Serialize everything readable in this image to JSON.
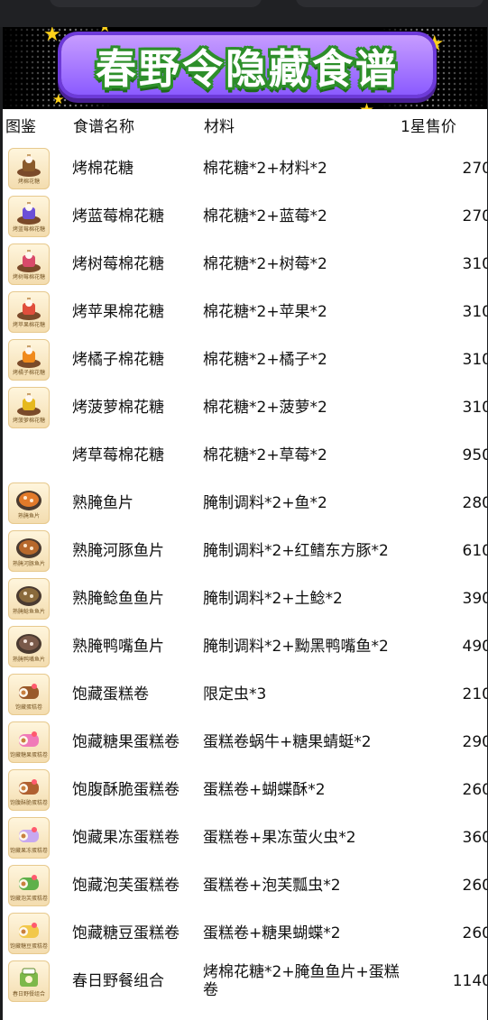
{
  "banner": {
    "title": "春野令隐藏食谱"
  },
  "columns": {
    "icon": "图鉴",
    "name": "食谱名称",
    "materials": "材料",
    "price": "1星售价"
  },
  "colors": {
    "banner_bg": "#000000",
    "title_fill": "#ffffff",
    "title_outline": "#2d8f2a",
    "title_box": "#8b5bff",
    "star": "#ffd21a"
  },
  "rows": [
    {
      "name": "烤棉花糖",
      "materials": "棉花糖*2+材料*2",
      "price": "270",
      "icon": "toasted-marshmallow-icon",
      "caption": "烤棉花糖"
    },
    {
      "name": "烤蓝莓棉花糖",
      "materials": "棉花糖*2+蓝莓*2",
      "price": "270",
      "icon": "blueberry-marshmallow-icon",
      "caption": "烤蓝莓棉花糖"
    },
    {
      "name": "烤树莓棉花糖",
      "materials": "棉花糖*2+树莓*2",
      "price": "310",
      "icon": "raspberry-marshmallow-icon",
      "caption": "烤树莓棉花糖"
    },
    {
      "name": "烤苹果棉花糖",
      "materials": "棉花糖*2+苹果*2",
      "price": "310",
      "icon": "apple-marshmallow-icon",
      "caption": "烤苹果棉花糖"
    },
    {
      "name": "烤橘子棉花糖",
      "materials": "棉花糖*2+橘子*2",
      "price": "310",
      "icon": "orange-marshmallow-icon",
      "caption": "烤橘子棉花糖"
    },
    {
      "name": "烤菠萝棉花糖",
      "materials": "棉花糖*2+菠萝*2",
      "price": "310",
      "icon": "pineapple-marshmallow-icon",
      "caption": "烤菠萝棉花糖"
    },
    {
      "name": "烤草莓棉花糖",
      "materials": "棉花糖*2+草莓*2",
      "price": "950",
      "icon": "",
      "caption": ""
    },
    {
      "name": "熟腌鱼片",
      "materials": "腌制调料*2+鱼*2",
      "price": "280",
      "icon": "pickled-fish-icon",
      "caption": "熟腌鱼片"
    },
    {
      "name": "熟腌河豚鱼片",
      "materials": "腌制调料*2+红鳍东方豚*2",
      "price": "610",
      "icon": "pickled-pufferfish-icon",
      "caption": "熟腌河豚鱼片"
    },
    {
      "name": "熟腌鲶鱼鱼片",
      "materials": "腌制调料*2+土鲶*2",
      "price": "390",
      "icon": "pickled-catfish-icon",
      "caption": "熟腌鲶鱼鱼片"
    },
    {
      "name": "熟腌鸭嘴鱼片",
      "materials": "腌制调料*2+黝黑鸭嘴鱼*2",
      "price": "490",
      "icon": "pickled-paddlefish-icon",
      "caption": "熟腌鸭嘴鱼片"
    },
    {
      "name": "饱藏蛋糕卷",
      "materials": "限定虫*3",
      "price": "210",
      "icon": "cake-roll-icon",
      "caption": "饱藏蛋糕卷"
    },
    {
      "name": "饱藏糖果蛋糕卷",
      "materials": "蛋糕卷蜗牛+糖果蜻蜓*2",
      "price": "290",
      "icon": "candy-cake-roll-icon",
      "caption": "饱藏糖果蛋糕卷"
    },
    {
      "name": "饱腹酥脆蛋糕卷",
      "materials": "蛋糕卷+蝴蝶酥*2",
      "price": "260",
      "icon": "crispy-cake-roll-icon",
      "caption": "饱腹酥脆蛋糕卷"
    },
    {
      "name": "饱藏果冻蛋糕卷",
      "materials": "蛋糕卷+果冻萤火虫*2",
      "price": "360",
      "icon": "jelly-cake-roll-icon",
      "caption": "饱藏果冻蛋糕卷"
    },
    {
      "name": "饱藏泡芙蛋糕卷",
      "materials": "蛋糕卷+泡芙瓢虫*2",
      "price": "260",
      "icon": "puff-cake-roll-icon",
      "caption": "饱藏泡芙蛋糕卷"
    },
    {
      "name": "饱藏糖豆蛋糕卷",
      "materials": "蛋糕卷+糖果蝴蝶*2",
      "price": "260",
      "icon": "jellybean-cake-roll-icon",
      "caption": "饱藏糖豆蛋糕卷"
    },
    {
      "name": "春日野餐组合",
      "materials": "烤棉花糖*2+腌鱼鱼片+蛋糕卷",
      "price": "1140",
      "icon": "picnic-set-icon",
      "caption": "春日野餐组合"
    }
  ]
}
